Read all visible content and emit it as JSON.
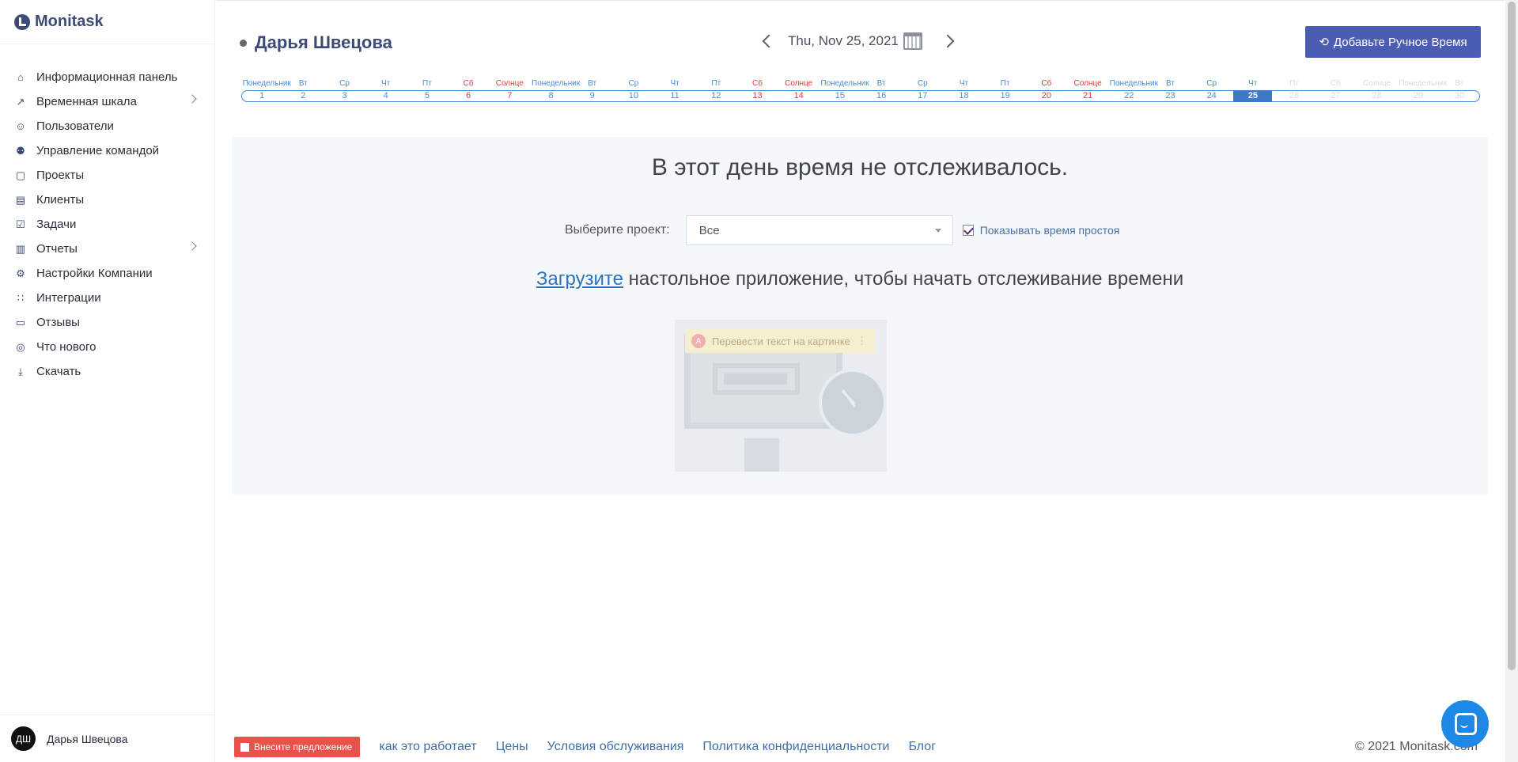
{
  "brand": {
    "name": "Monitask"
  },
  "sidebar": {
    "items": [
      {
        "label": "Информационная панель",
        "icon": "home-icon",
        "has_children": false
      },
      {
        "label": "Временная шкала",
        "icon": "trend-icon",
        "has_children": true
      },
      {
        "label": "Пользователи",
        "icon": "user-icon",
        "has_children": false
      },
      {
        "label": "Управление командой",
        "icon": "team-icon",
        "has_children": false
      },
      {
        "label": "Проекты",
        "icon": "folder-icon",
        "has_children": false
      },
      {
        "label": "Клиенты",
        "icon": "document-icon",
        "has_children": false
      },
      {
        "label": "Задачи",
        "icon": "calendar-check-icon",
        "has_children": false
      },
      {
        "label": "Отчеты",
        "icon": "chart-icon",
        "has_children": true
      },
      {
        "label": "Настройки Компании",
        "icon": "gear-icon",
        "has_children": false
      },
      {
        "label": "Интеграции",
        "icon": "grid-icon",
        "has_children": false
      },
      {
        "label": "Отзывы",
        "icon": "feedback-icon",
        "has_children": false
      },
      {
        "label": "Что нового",
        "icon": "rocket-icon",
        "has_children": false
      },
      {
        "label": "Скачать",
        "icon": "download-icon",
        "has_children": false
      }
    ],
    "user": {
      "initials": "ДШ",
      "name": "Дарья Швецова"
    }
  },
  "header": {
    "user_name": "Дарья Швецова",
    "date": "Thu, Nov 25, 2021",
    "add_time_button": "Добавьте Ручное Время"
  },
  "days": [
    {
      "name": "Понедельник",
      "num": "1",
      "type": "normal"
    },
    {
      "name": "Вт",
      "num": "2",
      "type": "normal"
    },
    {
      "name": "Ср",
      "num": "3",
      "type": "normal"
    },
    {
      "name": "Чт",
      "num": "4",
      "type": "normal"
    },
    {
      "name": "Пт",
      "num": "5",
      "type": "normal"
    },
    {
      "name": "Сб",
      "num": "6",
      "type": "weekend"
    },
    {
      "name": "Солнце",
      "num": "7",
      "type": "weekend"
    },
    {
      "name": "Понедельник",
      "num": "8",
      "type": "normal"
    },
    {
      "name": "Вт",
      "num": "9",
      "type": "normal"
    },
    {
      "name": "Ср",
      "num": "10",
      "type": "normal"
    },
    {
      "name": "Чт",
      "num": "11",
      "type": "normal"
    },
    {
      "name": "Пт",
      "num": "12",
      "type": "normal"
    },
    {
      "name": "Сб",
      "num": "13",
      "type": "weekend"
    },
    {
      "name": "Солнце",
      "num": "14",
      "type": "weekend"
    },
    {
      "name": "Понедельник",
      "num": "15",
      "type": "normal"
    },
    {
      "name": "Вт",
      "num": "16",
      "type": "normal"
    },
    {
      "name": "Ср",
      "num": "17",
      "type": "normal"
    },
    {
      "name": "Чт",
      "num": "18",
      "type": "normal"
    },
    {
      "name": "Пт",
      "num": "19",
      "type": "normal"
    },
    {
      "name": "Сб",
      "num": "20",
      "type": "weekend"
    },
    {
      "name": "Солнце",
      "num": "21",
      "type": "weekend"
    },
    {
      "name": "Понедельник",
      "num": "22",
      "type": "normal"
    },
    {
      "name": "Вт",
      "num": "23",
      "type": "normal"
    },
    {
      "name": "Ср",
      "num": "24",
      "type": "normal"
    },
    {
      "name": "Чт",
      "num": "25",
      "type": "active"
    },
    {
      "name": "Пт",
      "num": "26",
      "type": "future"
    },
    {
      "name": "Сб",
      "num": "27",
      "type": "future"
    },
    {
      "name": "Солнце",
      "num": "28",
      "type": "future"
    },
    {
      "name": "Понедельник",
      "num": "29",
      "type": "future"
    },
    {
      "name": "Вт",
      "num": "30",
      "type": "future"
    }
  ],
  "content": {
    "empty_title": "В этот день время не отслеживалось.",
    "project_label": "Выберите проект:",
    "project_value": "Все",
    "idle_checkbox_label": "Показывать время простоя",
    "idle_checked": true,
    "download_link": "Загрузите",
    "download_rest": " настольное приложение, чтобы начать отслеживание времени",
    "translate_popup": "Перевести текст на картинке"
  },
  "footer": {
    "suggest_button": "Внесите предложение",
    "links": [
      "как это работает",
      "Цены",
      "Условия обслуживания",
      "Политика конфиденциальности",
      "Блог"
    ],
    "copyright": "© 2021 Monitask.com"
  },
  "colors": {
    "brand": "#3c4a78",
    "primary_button": "#4a5cb4",
    "day_blue": "#4a8bd6",
    "weekend_red": "#e53935",
    "active_day": "#3d79c8",
    "suggest_red": "#e8524a",
    "chat_blue": "#1e88e5"
  }
}
